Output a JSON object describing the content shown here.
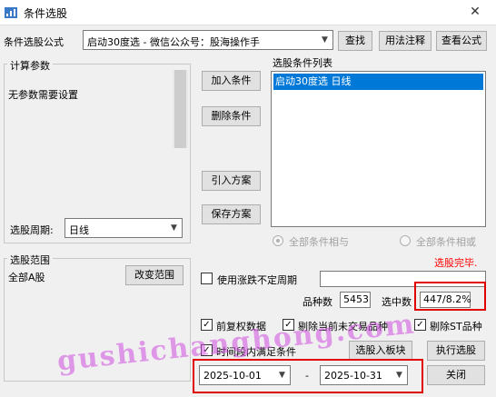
{
  "window": {
    "title": "条件选股",
    "close_glyph": "✕"
  },
  "formula": {
    "label": "条件选股公式",
    "value": "启动30度选  -  微信公众号：股海操作手",
    "find_btn": "查找",
    "usage_btn": "用法注释",
    "view_btn": "查看公式"
  },
  "params": {
    "title": "计算参数",
    "text": "无参数需要设置",
    "period_label": "选股周期:",
    "period_value": "日线"
  },
  "buttons": {
    "add": "加入条件",
    "delete": "删除条件",
    "import": "引入方案",
    "save": "保存方案"
  },
  "conditions": {
    "title": "选股条件列表",
    "items": [
      "启动30度选  日线"
    ]
  },
  "logic": {
    "and_label": "全部条件相与",
    "or_label": "全部条件相或"
  },
  "status": {
    "done_text": "选股完毕.",
    "done_color": "#ff0000"
  },
  "range": {
    "title": "选股范围",
    "value": "全部A股",
    "change_btn": "改变范围"
  },
  "options": {
    "use_unfixed_period": "使用涨跌不定周期",
    "stock_count_label": "品种数",
    "stock_count": "5453",
    "selected_label": "选中数",
    "selected_value": "447/8.2%",
    "pre_adjusted": "前复权数据",
    "exclude_untraded": "剔除当前未交易品种",
    "exclude_st": "剔除ST品种",
    "time_range": "时间段内满足条件",
    "to_block_btn": "选股入板块",
    "execute_btn": "执行选股",
    "date_from": "2025-10-01",
    "date_sep": "-",
    "date_to": "2025-10-31",
    "close_btn": "关闭"
  },
  "watermark": "gushichanghong.com",
  "colors": {
    "selected_row": "#0078d7",
    "highlight": "#e00000"
  }
}
